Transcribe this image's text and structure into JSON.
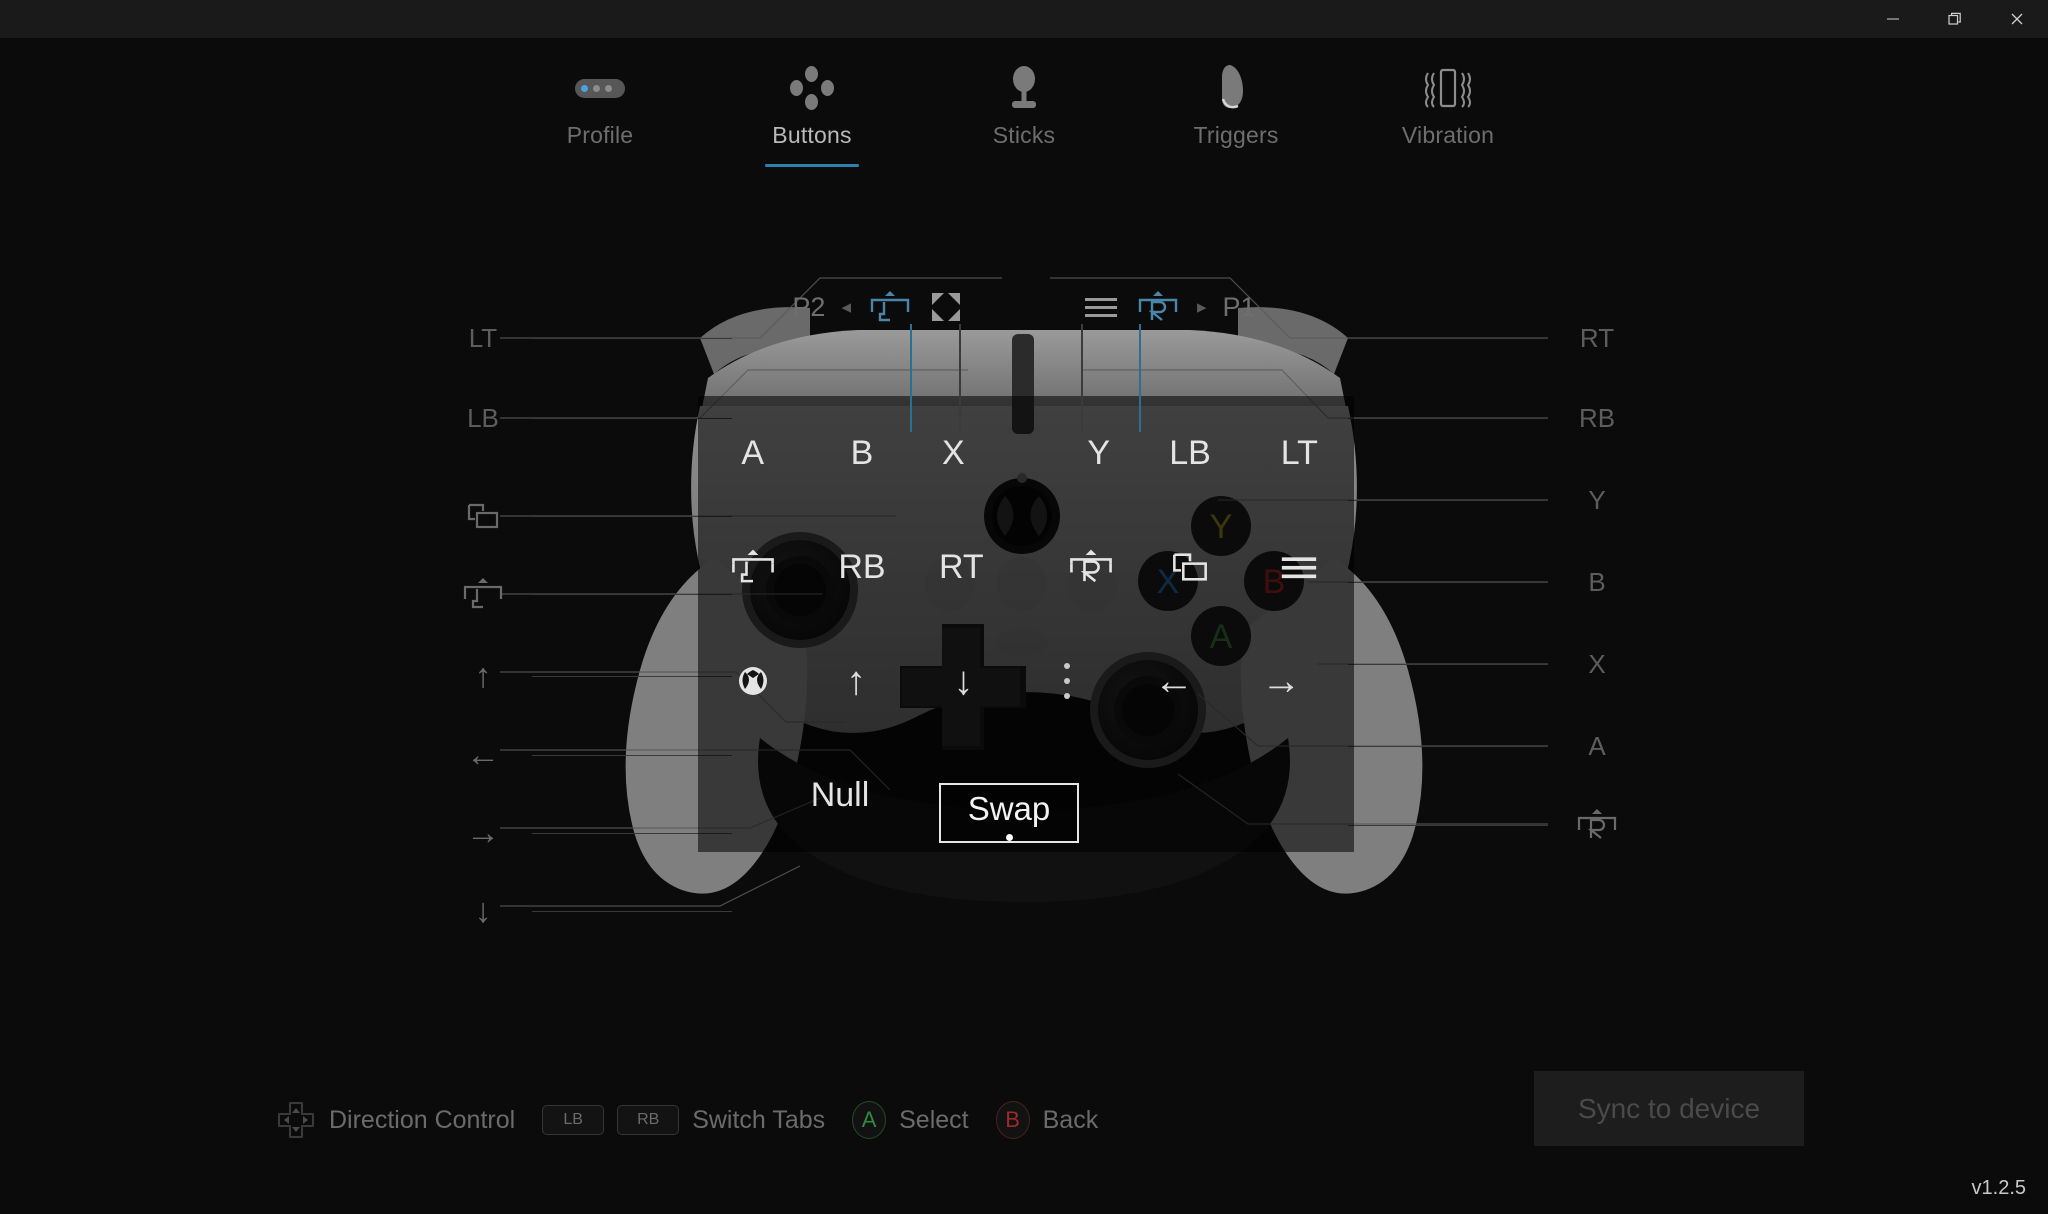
{
  "window": {
    "controls": [
      {
        "name": "minimize",
        "glyph": "minimize-icon"
      },
      {
        "name": "maximize",
        "glyph": "restore-icon"
      },
      {
        "name": "close",
        "glyph": "close-icon"
      }
    ]
  },
  "tabs": [
    {
      "label": "Profile",
      "icon": "profile-pill-icon",
      "active": false
    },
    {
      "label": "Buttons",
      "icon": "four-dots-icon",
      "active": true
    },
    {
      "label": "Sticks",
      "icon": "thumbstick-icon",
      "active": false
    },
    {
      "label": "Triggers",
      "icon": "trigger-icon",
      "active": false
    },
    {
      "label": "Vibration",
      "icon": "vibration-icon",
      "active": false
    }
  ],
  "selector": {
    "left_player": "P2",
    "left_arrow": "◂",
    "left_paddle_icon": "left-paddle-icon",
    "expand_icon": "expand-icon",
    "menu_icon": "menu-icon",
    "right_paddle_icon": "right-paddle-icon",
    "right_arrow": "▸",
    "right_player": "P1"
  },
  "left_callouts": [
    {
      "label": "LT",
      "type": "text"
    },
    {
      "label": "LB",
      "type": "text"
    },
    {
      "label": "view-icon",
      "type": "icon"
    },
    {
      "label": "left-paddle-icon",
      "type": "icon"
    },
    {
      "label": "↑",
      "type": "text"
    },
    {
      "label": "←",
      "type": "text"
    },
    {
      "label": "→",
      "type": "text"
    },
    {
      "label": "↓",
      "type": "text"
    }
  ],
  "right_callouts": [
    {
      "label": "RT",
      "type": "text"
    },
    {
      "label": "RB",
      "type": "text"
    },
    {
      "label": "Y",
      "type": "text"
    },
    {
      "label": "B",
      "type": "text"
    },
    {
      "label": "X",
      "type": "text"
    },
    {
      "label": "A",
      "type": "text"
    },
    {
      "label": "right-paddle-icon",
      "type": "icon"
    }
  ],
  "overlay_grid": {
    "rows": [
      [
        {
          "label": "A",
          "type": "text"
        },
        {
          "label": "B",
          "type": "text"
        },
        {
          "label": "X",
          "type": "text"
        },
        {
          "label": "",
          "type": "empty"
        },
        {
          "label": "Y",
          "type": "text"
        },
        {
          "label": "LB",
          "type": "text"
        },
        {
          "label": "LT",
          "type": "text"
        }
      ],
      [
        {
          "label": "left-paddle-icon",
          "type": "icon"
        },
        {
          "label": "RB",
          "type": "text"
        },
        {
          "label": "RT",
          "type": "text"
        },
        {
          "label": "",
          "type": "empty"
        },
        {
          "label": "right-paddle-icon",
          "type": "icon"
        },
        {
          "label": "view-icon",
          "type": "icon"
        },
        {
          "label": "menu-icon",
          "type": "icon"
        }
      ],
      [
        {
          "label": "xbox-icon",
          "type": "icon"
        },
        {
          "label": "↑",
          "type": "text"
        },
        {
          "label": "↓",
          "type": "text"
        },
        {
          "label": "vdots",
          "type": "icon"
        },
        {
          "label": "←",
          "type": "text"
        },
        {
          "label": "→",
          "type": "text"
        },
        {
          "label": "",
          "type": "empty"
        }
      ],
      [
        {
          "label": "",
          "type": "empty"
        },
        {
          "label": "Null",
          "type": "text"
        },
        {
          "label": "",
          "type": "empty"
        },
        {
          "label": "",
          "type": "empty"
        },
        {
          "label": "",
          "type": "empty"
        },
        {
          "label": "",
          "type": "empty"
        },
        {
          "label": "",
          "type": "empty"
        }
      ]
    ]
  },
  "swap": {
    "label": "Swap",
    "selected_dot": true
  },
  "hints": [
    {
      "icon": "dpad-icon",
      "keys": [],
      "label": "Direction Control"
    },
    {
      "icon": "",
      "keys": [
        "LB",
        "RB"
      ],
      "label": "Switch Tabs"
    },
    {
      "icon": "a-button",
      "keys": [],
      "label": "Select"
    },
    {
      "icon": "b-button",
      "keys": [],
      "label": "Back"
    }
  ],
  "sync": {
    "label": "Sync to device",
    "enabled": false
  },
  "version": "v1.2.5",
  "colors": {
    "accent": "#2f7fb5",
    "accent_line": "#2e6d94",
    "bg": "#0b0b0b",
    "titlebar": "#1a1a1a",
    "a_green": "#2f8a3d",
    "b_red": "#9c2a2a",
    "x_blue": "#1f5f97",
    "y_yellow": "#8a7a1c"
  }
}
